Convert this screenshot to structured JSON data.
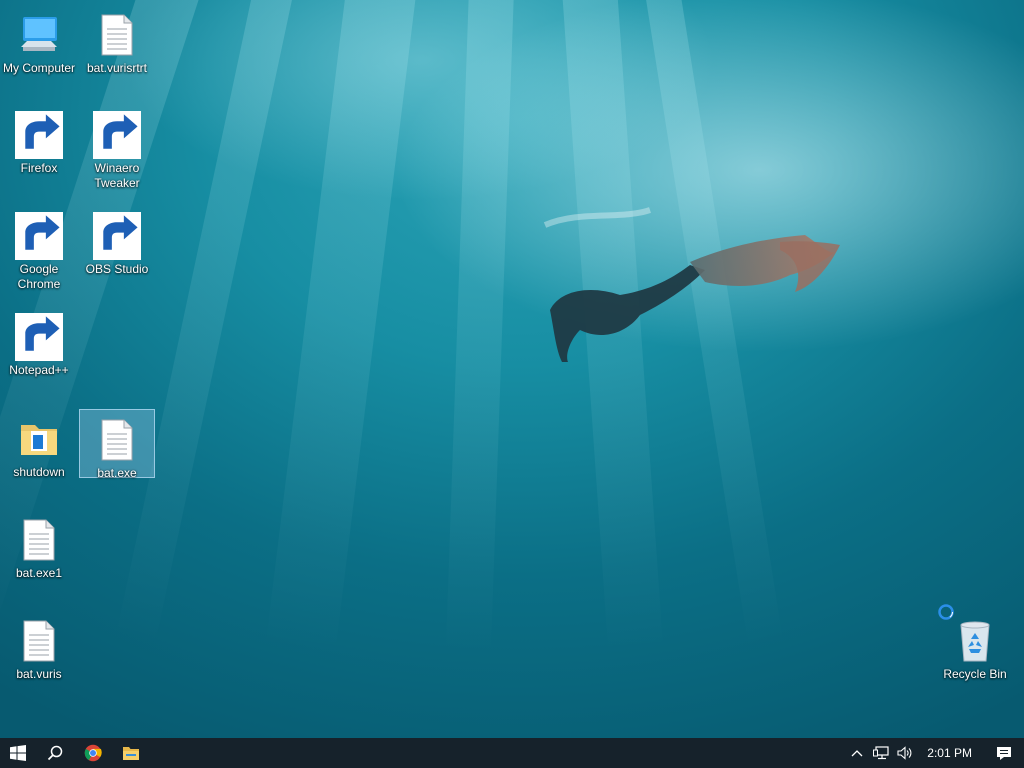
{
  "desktop": {
    "icons": [
      {
        "id": "my-computer",
        "label": "My Computer",
        "icon": "computer-icon",
        "shortcut": false
      },
      {
        "id": "bat-vurisrtrt",
        "label": "bat.vurisrtrt",
        "icon": "document-icon",
        "shortcut": false
      },
      {
        "id": "firefox",
        "label": "Firefox",
        "icon": "firefox-icon",
        "shortcut": true
      },
      {
        "id": "winaero-tweaker",
        "label": "Winaero Tweaker",
        "icon": "winaero-icon",
        "shortcut": true
      },
      {
        "id": "google-chrome",
        "label": "Google Chrome",
        "icon": "chrome-icon",
        "shortcut": true
      },
      {
        "id": "obs-studio",
        "label": "OBS Studio",
        "icon": "obs-icon",
        "shortcut": true
      },
      {
        "id": "notepad-plus-plus",
        "label": "Notepad++",
        "icon": "notepadpp-icon",
        "shortcut": true
      },
      {
        "id": "shutdown",
        "label": "shutdown",
        "icon": "folder-icon",
        "shortcut": false
      },
      {
        "id": "bat-exe",
        "label": "bat.exe",
        "icon": "document-icon",
        "shortcut": false,
        "selected": true
      },
      {
        "id": "bat-exe1",
        "label": "bat.exe1",
        "icon": "document-icon",
        "shortcut": false
      },
      {
        "id": "bat-vuris",
        "label": "bat.vuris",
        "icon": "document-icon",
        "shortcut": false
      },
      {
        "id": "recycle-bin",
        "label": "Recycle Bin",
        "icon": "recycle-bin-icon",
        "shortcut": false
      }
    ]
  },
  "taskbar": {
    "start": "windows-logo-icon",
    "search": "search-icon",
    "pinned": [
      "chrome-icon",
      "file-explorer-icon"
    ],
    "tray": {
      "icons": [
        "chevron-up-icon",
        "network-icon",
        "volume-icon"
      ],
      "clock": "2:01 PM",
      "notifications": "action-center-icon"
    }
  },
  "colors": {
    "taskbar": "#16222b",
    "selection": "#a0d2f0",
    "accent": "#0078d7"
  }
}
